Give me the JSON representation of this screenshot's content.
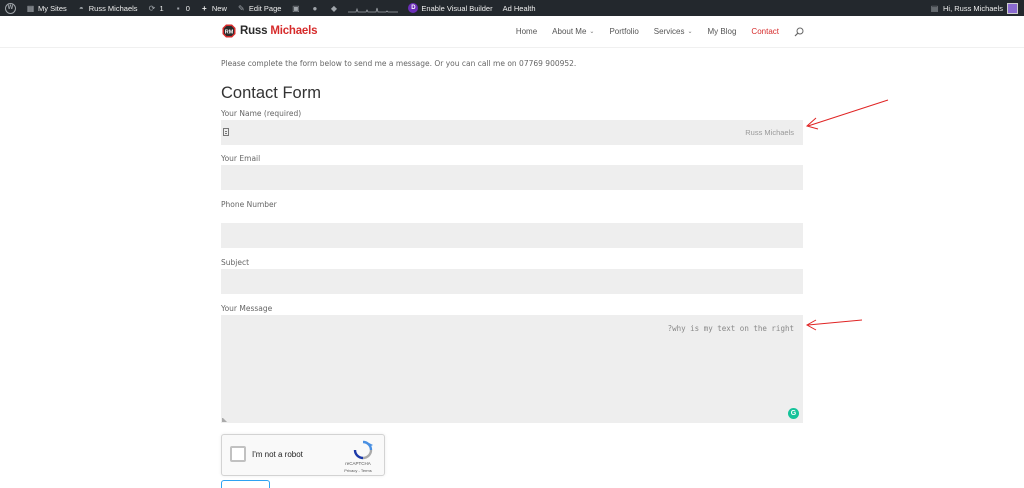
{
  "adminbar": {
    "my_sites": "My Sites",
    "site_name": "Russ Michaels",
    "updates_count": "1",
    "comments_count": "0",
    "new_label": "New",
    "edit_page": "Edit Page",
    "enable_visual_builder": "Enable Visual Builder",
    "ad_health": "Ad Health",
    "greeting": "Hi, Russ Michaels",
    "divi_letter": "D"
  },
  "header": {
    "logo_first": "Russ",
    "logo_second": " Michaels",
    "nav": [
      {
        "label": "Home",
        "has_dropdown": false
      },
      {
        "label": "About Me",
        "has_dropdown": true
      },
      {
        "label": "Portfolio",
        "has_dropdown": false
      },
      {
        "label": "Services",
        "has_dropdown": true
      },
      {
        "label": "My Blog",
        "has_dropdown": false
      },
      {
        "label": "Contact",
        "has_dropdown": false,
        "active": true
      }
    ]
  },
  "page": {
    "intro": "Please complete the form below to send me a message. Or you can call me on 07769 900952.",
    "title": "Contact Form"
  },
  "form": {
    "name_label": "Your Name (required)",
    "name_value": "Russ Michaels",
    "email_label": "Your Email",
    "email_value": "",
    "phone_label": "Phone Number",
    "phone_value": "",
    "subject_label": "Subject",
    "subject_value": "",
    "message_label": "Your Message",
    "message_value": "?why is my text on the right"
  },
  "recaptcha": {
    "label": "I'm not a robot",
    "brand": "reCAPTCHA",
    "terms": "Privacy - Terms"
  },
  "colors": {
    "accent_red": "#d62b2b",
    "adminbar_bg": "#23282d",
    "field_bg": "#eeeeee",
    "link_blue": "#2ea3f2",
    "grammarly_green": "#15c39a"
  }
}
